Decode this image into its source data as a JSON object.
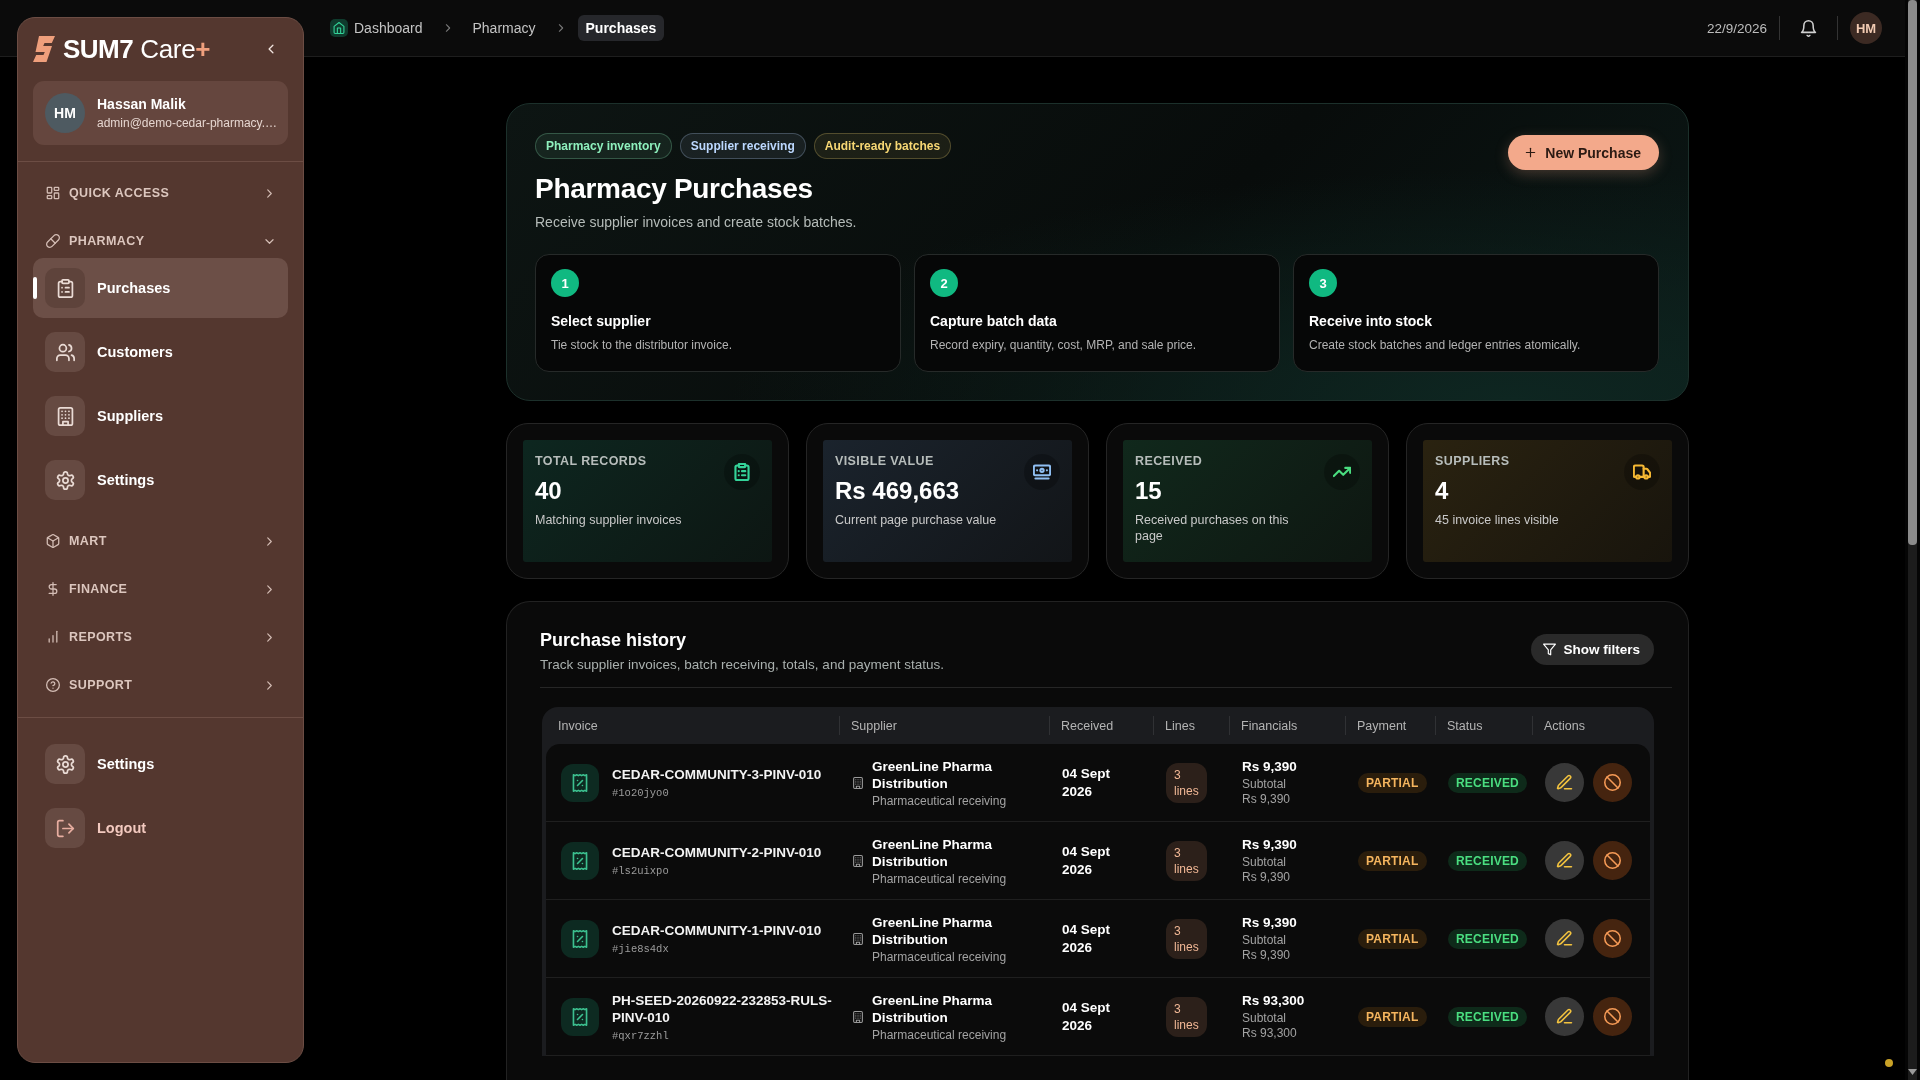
{
  "sidebar": {
    "brand": {
      "name": "SUM7",
      "product": "Care",
      "mark": "+"
    },
    "user": {
      "initials": "HM",
      "name": "Hassan Malik",
      "email": "admin@demo-cedar-pharmacy.…"
    },
    "sections": [
      {
        "label": "QUICK ACCESS",
        "kind": "quick",
        "expanded": false
      },
      {
        "label": "PHARMACY",
        "kind": "pharmacy",
        "expanded": true,
        "children": [
          {
            "label": "Purchases",
            "kind": "purchases",
            "selected": true
          },
          {
            "label": "Customers",
            "kind": "customers",
            "selected": false
          },
          {
            "label": "Suppliers",
            "kind": "suppliers",
            "selected": false
          },
          {
            "label": "Settings",
            "kind": "settings",
            "selected": false
          }
        ]
      },
      {
        "label": "MART",
        "kind": "mart",
        "expanded": false
      },
      {
        "label": "FINANCE",
        "kind": "finance",
        "expanded": false
      },
      {
        "label": "REPORTS",
        "kind": "reports",
        "expanded": false
      },
      {
        "label": "SUPPORT",
        "kind": "support",
        "expanded": false
      }
    ],
    "footer": [
      {
        "label": "Settings",
        "kind": "settings"
      },
      {
        "label": "Logout",
        "kind": "logout"
      }
    ]
  },
  "topbar": {
    "breadcrumbs": [
      {
        "label": "Dashboard",
        "kind": "home",
        "selected": false
      },
      {
        "label": "Pharmacy",
        "kind": "page",
        "selected": false
      },
      {
        "label": "Purchases",
        "kind": "page",
        "selected": true
      }
    ],
    "date": "22/9/2026",
    "avatar": "HM"
  },
  "hero": {
    "tags": [
      {
        "label": "Pharmacy inventory",
        "color": "#8ef0bd"
      },
      {
        "label": "Supplier receiving",
        "color": "#bcd8ff"
      },
      {
        "label": "Audit-ready batches",
        "color": "#f7d774"
      }
    ],
    "title": "Pharmacy Purchases",
    "subtitle": "Receive supplier invoices and create stock batches.",
    "action": "New Purchase",
    "steps": [
      {
        "number": "1",
        "title": "Select supplier",
        "description": "Tie stock to the distributor invoice."
      },
      {
        "number": "2",
        "title": "Capture batch data",
        "description": "Record expiry, quantity, cost, MRP, and sale price."
      },
      {
        "number": "3",
        "title": "Receive into stock",
        "description": "Create stock batches and ledger entries atomically."
      }
    ]
  },
  "stats": [
    {
      "label": "TOTAL RECORDS",
      "value": "40",
      "description": "Matching supplier invoices",
      "kind": "records",
      "color": "#34d399"
    },
    {
      "label": "VISIBLE VALUE",
      "value": "Rs 469,663",
      "description": "Current page purchase value",
      "kind": "value",
      "color": "#8fbef2"
    },
    {
      "label": "RECEIVED",
      "value": "15",
      "description": "Received purchases on this page",
      "kind": "received",
      "color": "#4ade80"
    },
    {
      "label": "SUPPLIERS",
      "value": "4",
      "description": "45 invoice lines visible",
      "kind": "suppliers",
      "color": "#f5b833"
    }
  ],
  "history": {
    "title": "Purchase history",
    "subtitle": "Track supplier invoices, batch receiving, totals, and payment status.",
    "filter_button": "Show filters",
    "columns": [
      "Invoice",
      "Supplier",
      "Received",
      "Lines",
      "Financials",
      "Payment",
      "Status",
      "Actions"
    ],
    "rows": [
      {
        "invoice": "CEDAR-COMMUNITY-3-PINV-010",
        "reference": "#1o20jyo0",
        "supplier": "GreenLine Pharma Distribution",
        "supplier_type": "Pharmaceutical receiving",
        "received": "04 Sept 2026",
        "lines": "3 lines",
        "total": "Rs 9,390",
        "subtotal_label": "Subtotal",
        "subtotal": "Rs 9,390",
        "payment": {
          "label": "PARTIAL",
          "kind": "partial"
        },
        "status": {
          "label": "RECEIVED",
          "kind": "received"
        }
      },
      {
        "invoice": "CEDAR-COMMUNITY-2-PINV-010",
        "reference": "#ls2uixpo",
        "supplier": "GreenLine Pharma Distribution",
        "supplier_type": "Pharmaceutical receiving",
        "received": "04 Sept 2026",
        "lines": "3 lines",
        "total": "Rs 9,390",
        "subtotal_label": "Subtotal",
        "subtotal": "Rs 9,390",
        "payment": {
          "label": "PARTIAL",
          "kind": "partial"
        },
        "status": {
          "label": "RECEIVED",
          "kind": "received"
        }
      },
      {
        "invoice": "CEDAR-COMMUNITY-1-PINV-010",
        "reference": "#jie8s4dx",
        "supplier": "GreenLine Pharma Distribution",
        "supplier_type": "Pharmaceutical receiving",
        "received": "04 Sept 2026",
        "lines": "3 lines",
        "total": "Rs 9,390",
        "subtotal_label": "Subtotal",
        "subtotal": "Rs 9,390",
        "payment": {
          "label": "PARTIAL",
          "kind": "partial"
        },
        "status": {
          "label": "RECEIVED",
          "kind": "received"
        }
      },
      {
        "invoice": "PH-SEED-20260922-232853-RULS-PINV-010",
        "reference": "#qxr7zzhl",
        "supplier": "GreenLine Pharma Distribution",
        "supplier_type": "Pharmaceutical receiving",
        "received": "04 Sept 2026",
        "lines": "3 lines",
        "total": "Rs 93,300",
        "subtotal_label": "Subtotal",
        "subtotal": "Rs 93,300",
        "payment": {
          "label": "PARTIAL",
          "kind": "partial"
        },
        "status": {
          "label": "RECEIVED",
          "kind": "received"
        }
      }
    ]
  }
}
